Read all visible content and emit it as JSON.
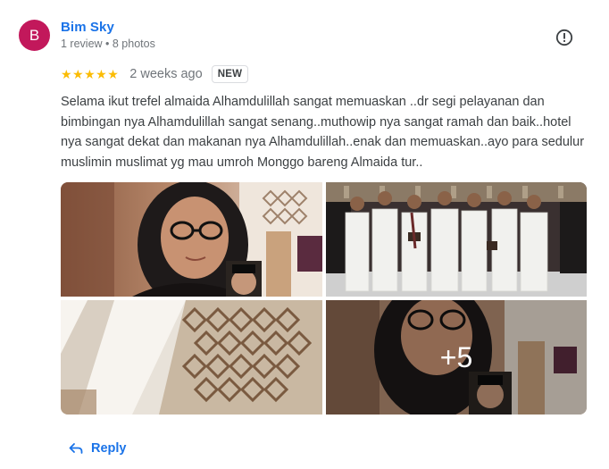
{
  "reviewer": {
    "avatar_letter": "B",
    "avatar_color": "#c2185b",
    "name": "Bim Sky",
    "meta": "1 review • 8 photos"
  },
  "review": {
    "stars": "★★★★★",
    "rating": 5,
    "time": "2 weeks ago",
    "badge": "NEW",
    "text": "Selama ikut trefel almaida Alhamdulillah sangat memuaskan ..dr segi pelayanan dan bimbingan nya Alhamdulillah sangat senang..muthowip nya sangat ramah dan baik..hotel nya sangat dekat dan makanan nya Alhamdulillah..enak dan memuaskan..ayo para sedulur muslimin muslimat yg mau umroh Monggo bareng Almaida tur.."
  },
  "photos": {
    "more_count": "+5",
    "items": [
      "selfie-photo",
      "group-photo",
      "ceiling-photo",
      "selfie-photo-2"
    ]
  },
  "actions": {
    "reply_label": "Reply",
    "reply_icon": "reply-arrow-icon",
    "report_icon": "report-flag-icon"
  },
  "colors": {
    "link": "#1a73e8",
    "star": "#fbbc04",
    "meta": "#70757a"
  }
}
